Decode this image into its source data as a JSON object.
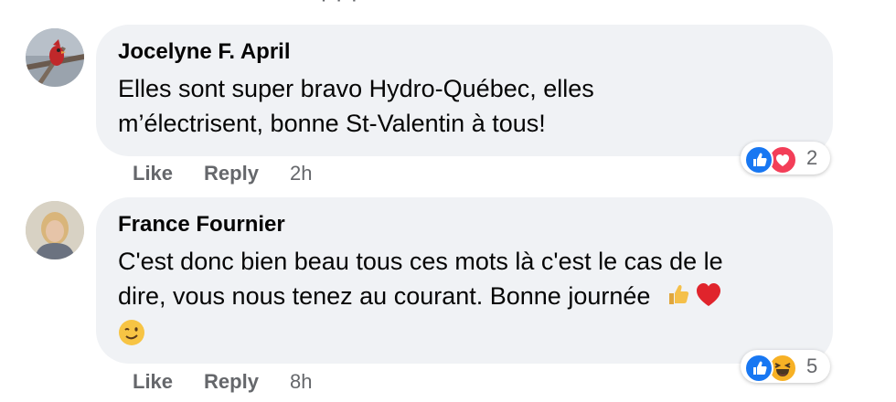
{
  "comments": [
    {
      "author": "Jocelyne F. April",
      "text_line1": "Elles sont super bravo Hydro-Québec, elles",
      "text_line2": "m’électrisent, bonne St-Valentin à tous!",
      "reaction_count": "2",
      "reaction_icons": [
        "like-icon",
        "love-icon"
      ],
      "actions": {
        "like": "Like",
        "reply": "Reply",
        "time": "2h"
      }
    },
    {
      "author": "France Fournier",
      "text_line1": "C'est donc bien beau tous ces mots là c'est le cas de le",
      "text_line2": "dire, vous nous tenez au courant. Bonne journée",
      "inline_emojis": [
        "thumbs-up-emoji",
        "red-heart-emoji",
        "winking-face-emoji"
      ],
      "reaction_count": "5",
      "reaction_icons": [
        "like-icon",
        "haha-icon"
      ],
      "actions": {
        "like": "Like",
        "reply": "Reply",
        "time": "8h"
      }
    }
  ],
  "colors": {
    "bubble": "#f0f2f5",
    "meta_text": "#65676b",
    "like_blue": "#1877f2",
    "love_red": "#f33e58",
    "haha_yellow": "#f7b125"
  }
}
